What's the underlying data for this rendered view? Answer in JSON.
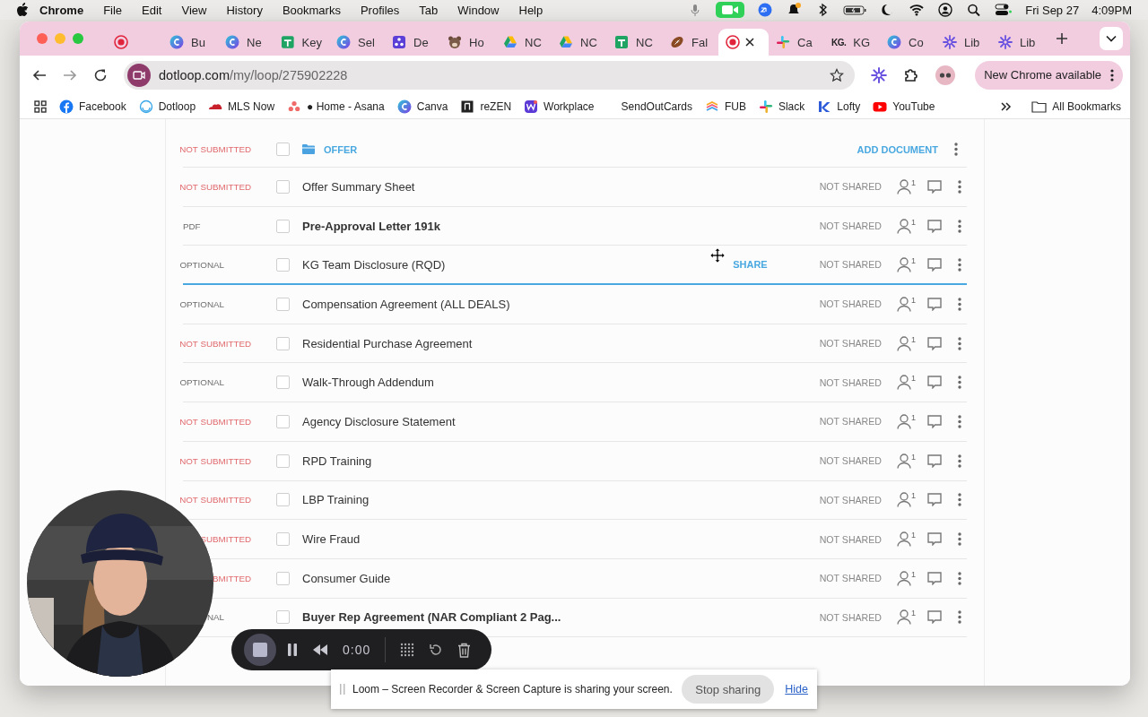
{
  "menu_bar": {
    "app": "Chrome",
    "menus": [
      "File",
      "Edit",
      "View",
      "History",
      "Bookmarks",
      "Profiles",
      "Tab",
      "Window",
      "Help"
    ],
    "date": "Fri Sep 27",
    "time": "4:09PM"
  },
  "tabs": [
    {
      "kind": "record",
      "selected": false
    },
    {
      "kind": "c-logo",
      "title": "Bu",
      "selected": false
    },
    {
      "kind": "c-logo",
      "title": "Ne",
      "selected": false
    },
    {
      "kind": "sheet",
      "title": "Key",
      "selected": false
    },
    {
      "kind": "c-logo",
      "title": "Sel",
      "selected": false
    },
    {
      "kind": "square-logo",
      "title": "De",
      "selected": false
    },
    {
      "kind": "bear",
      "title": "Ho",
      "selected": false
    },
    {
      "kind": "triangle",
      "title": "NC",
      "selected": false
    },
    {
      "kind": "triangle",
      "title": "NC",
      "selected": false
    },
    {
      "kind": "sheet",
      "title": "NC",
      "selected": false
    },
    {
      "kind": "football",
      "title": "Fal",
      "selected": false
    },
    {
      "kind": "record",
      "selected": true
    },
    {
      "kind": "hash",
      "title": "Ca",
      "selected": false
    },
    {
      "kind": "text-logo",
      "logo": "KG.",
      "title": "KG",
      "selected": false
    },
    {
      "kind": "c-logo",
      "title": "Co",
      "selected": false
    },
    {
      "kind": "sunburst",
      "title": "Lib",
      "selected": false
    },
    {
      "kind": "sunburst",
      "title": "Lib",
      "selected": false
    }
  ],
  "address_bar": {
    "domain": "dotloop.com",
    "path": "/my/loop/275902228"
  },
  "update_button": "New Chrome available",
  "bookmarks": [
    {
      "kind": "facebook",
      "label": "Facebook"
    },
    {
      "kind": "ring",
      "label": "Dotloop"
    },
    {
      "kind": "cloud",
      "label": "MLS Now"
    },
    {
      "kind": "dots",
      "label": "● Home - Asana"
    },
    {
      "kind": "c-logo",
      "label": "Canva"
    },
    {
      "kind": "square",
      "label": "reZEN"
    },
    {
      "kind": "w-logo",
      "label": "Workplace"
    },
    {
      "kind": "none",
      "label": "SendOutCards"
    },
    {
      "kind": "layers",
      "label": "FUB"
    },
    {
      "kind": "hash",
      "label": "Slack"
    },
    {
      "kind": "k-logo",
      "label": "Lofty"
    },
    {
      "kind": "play",
      "label": "YouTube"
    }
  ],
  "all_bookmarks": "All Bookmarks",
  "folder": {
    "status": "NOT SUBMITTED",
    "kind": "not_submitted",
    "checked": false,
    "name": "OFFER",
    "action": "ADD DOCUMENT"
  },
  "documents": [
    {
      "status": "NOT SUBMITTED",
      "kind": "not_submitted",
      "checked": false,
      "name": "Offer Summary Sheet",
      "bold": false,
      "hovered": false,
      "sharing": "NOT SHARED",
      "assignees": "1"
    },
    {
      "status": "PDF",
      "kind": "pdf",
      "checked": false,
      "name": "Pre-Approval Letter 191k",
      "bold": true,
      "hovered": false,
      "sharing": "NOT SHARED",
      "assignees": "1"
    },
    {
      "status": "OPTIONAL",
      "kind": "optional",
      "checked": false,
      "name": "KG Team Disclosure (RQD)",
      "bold": false,
      "hovered": true,
      "share": "SHARE",
      "sharing": "NOT SHARED",
      "assignees": "1"
    },
    {
      "status": "OPTIONAL",
      "kind": "optional",
      "checked": false,
      "name": "Compensation Agreement (ALL DEALS)",
      "bold": false,
      "hovered": false,
      "sharing": "NOT SHARED",
      "assignees": "1"
    },
    {
      "status": "NOT SUBMITTED",
      "kind": "not_submitted",
      "checked": false,
      "name": "Residential Purchase Agreement",
      "bold": false,
      "hovered": false,
      "sharing": "NOT SHARED",
      "assignees": "1"
    },
    {
      "status": "OPTIONAL",
      "kind": "optional",
      "checked": false,
      "name": "Walk-Through Addendum",
      "bold": false,
      "hovered": false,
      "sharing": "NOT SHARED",
      "assignees": "1"
    },
    {
      "status": "NOT SUBMITTED",
      "kind": "not_submitted",
      "checked": false,
      "name": "Agency Disclosure Statement",
      "bold": false,
      "hovered": false,
      "sharing": "NOT SHARED",
      "assignees": "1"
    },
    {
      "status": "NOT SUBMITTED",
      "kind": "not_submitted",
      "checked": false,
      "name": "RPD Training",
      "bold": false,
      "hovered": false,
      "sharing": "NOT SHARED",
      "assignees": "1"
    },
    {
      "status": "NOT SUBMITTED",
      "kind": "not_submitted",
      "checked": false,
      "name": "LBP Training",
      "bold": false,
      "hovered": false,
      "sharing": "NOT SHARED",
      "assignees": "1"
    },
    {
      "status": "SUBMITTED",
      "kind": "not_submitted",
      "checked": false,
      "name": "Wire Fraud",
      "bold": false,
      "hovered": false,
      "sharing": "NOT SHARED",
      "assignees": "1"
    },
    {
      "status": "BMITTED",
      "kind": "not_submitted",
      "checked": false,
      "name": "Consumer Guide",
      "bold": false,
      "hovered": false,
      "sharing": "NOT SHARED",
      "assignees": "1"
    },
    {
      "status": "NAL",
      "kind": "optional",
      "checked": false,
      "name": "Buyer Rep Agreement (NAR Compliant 2 Pag...",
      "bold": true,
      "hovered": false,
      "sharing": "NOT SHARED",
      "assignees": "1"
    }
  ],
  "recorder": {
    "time": "0:00"
  },
  "share_notice": {
    "message": "Loom – Screen Recorder & Screen Capture is sharing your screen.",
    "stop": "Stop sharing",
    "hide": "Hide"
  }
}
